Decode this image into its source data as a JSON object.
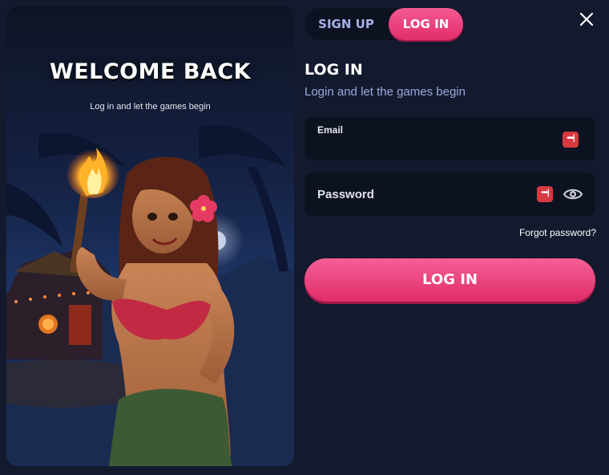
{
  "hero": {
    "title": "WELCOME BACK",
    "subtitle": "Log in and let the games begin"
  },
  "tabs": [
    {
      "label": "SIGN UP",
      "active": false
    },
    {
      "label": "LOG IN",
      "active": true
    }
  ],
  "form": {
    "title": "LOG IN",
    "subtitle": "Login and let the games begin",
    "email": {
      "label": "Email",
      "value": ""
    },
    "password": {
      "label": "Password",
      "value": ""
    },
    "forgot": "Forgot password?",
    "submit": "LOG IN"
  },
  "colors": {
    "background": "#141a2e",
    "field": "#0d1221",
    "accent": "#e8336f",
    "subtitle": "#9aa8df"
  },
  "icons": {
    "close": "close-icon",
    "password_manager": "password-manager-icon",
    "toggle_visibility": "eye-icon"
  }
}
